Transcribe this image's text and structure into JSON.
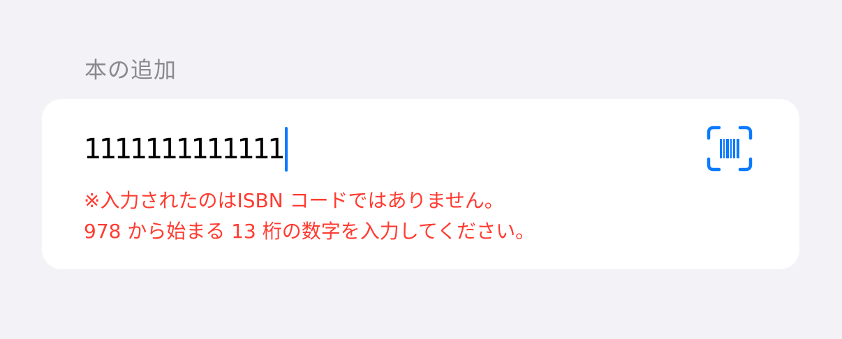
{
  "section": {
    "header": "本の追加"
  },
  "isbn_input": {
    "value": "1111111111111",
    "caret_color": "#0a7aff"
  },
  "scan_button": {
    "icon": "barcode-viewfinder-icon",
    "color": "#0a7aff"
  },
  "error": {
    "line1": "※入力されたのはISBN コードではありません。",
    "line2": "978 から始まる 13 桁の数字を入力してください。",
    "color": "#ff3b30"
  },
  "colors": {
    "background": "#f2f2f7",
    "card": "#ffffff",
    "header_text": "#8a8a8e"
  }
}
